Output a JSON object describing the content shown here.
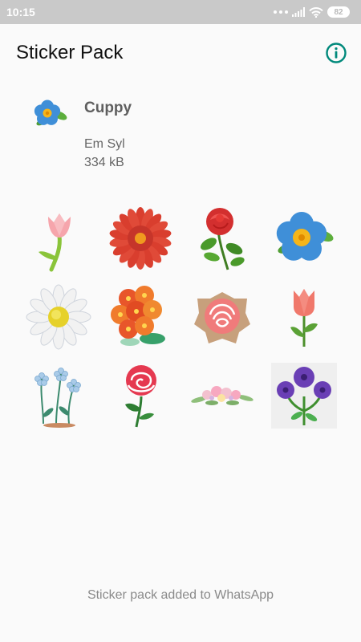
{
  "status_bar": {
    "time": "10:15",
    "battery": "82",
    "icons": [
      "dots-icon",
      "signal-icon",
      "wifi-icon",
      "battery-icon"
    ]
  },
  "toolbar": {
    "title": "Sticker Pack",
    "info_icon": "info-icon",
    "accent_color": "#00897b"
  },
  "pack": {
    "name": "Cuppy",
    "publisher": "Em Syl",
    "size": "334 kB",
    "tray_icon": "forget-me-not-icon"
  },
  "stickers": [
    {
      "icon": "pink-tulip-sticker"
    },
    {
      "icon": "red-gerbera-sticker"
    },
    {
      "icon": "red-rose-sticker"
    },
    {
      "icon": "blue-flower-sticker"
    },
    {
      "icon": "white-daisy-sticker"
    },
    {
      "icon": "orange-bouquet-sticker"
    },
    {
      "icon": "paper-rose-sticker"
    },
    {
      "icon": "coral-tulip-sticker"
    },
    {
      "icon": "blue-wildflowers-sticker"
    },
    {
      "icon": "rose-outline-sticker"
    },
    {
      "icon": "floral-garland-sticker"
    },
    {
      "icon": "purple-flowers-sticker"
    }
  ],
  "footer": {
    "message": "Sticker pack added to WhatsApp"
  }
}
